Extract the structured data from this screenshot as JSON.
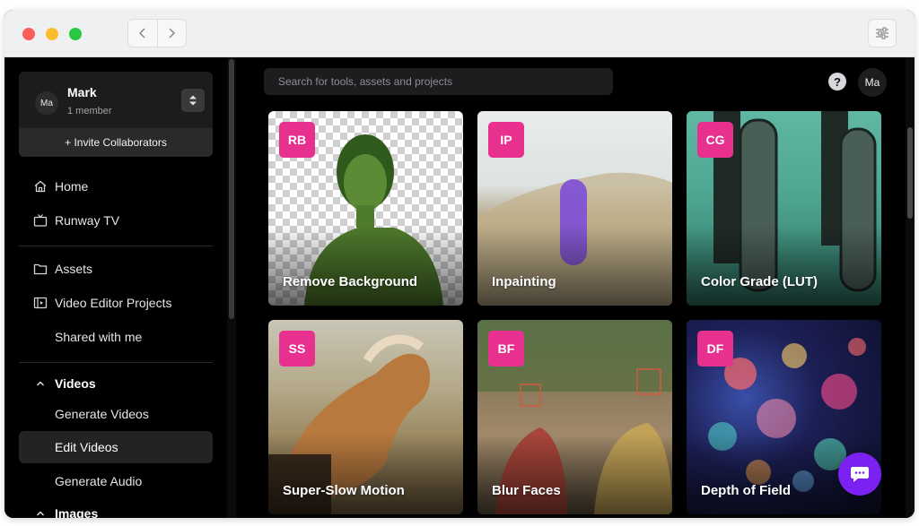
{
  "workspace": {
    "avatar": "Ma",
    "name": "Mark",
    "members": "1 member",
    "invite": "+ Invite Collaborators"
  },
  "nav": {
    "home": "Home",
    "runway_tv": "Runway TV",
    "assets": "Assets",
    "video_editor_projects": "Video Editor Projects",
    "shared_with_me": "Shared with me",
    "videos": "Videos",
    "generate_videos": "Generate Videos",
    "edit_videos": "Edit Videos",
    "generate_audio": "Generate Audio",
    "images": "Images"
  },
  "search": {
    "placeholder": "Search for tools, assets and projects"
  },
  "header": {
    "help": "?",
    "user_avatar": "Ma"
  },
  "tools": [
    {
      "badge": "RB",
      "title": "Remove Background"
    },
    {
      "badge": "IP",
      "title": "Inpainting"
    },
    {
      "badge": "CG",
      "title": "Color Grade (LUT)"
    },
    {
      "badge": "SS",
      "title": "Super-Slow Motion"
    },
    {
      "badge": "BF",
      "title": "Blur Faces"
    },
    {
      "badge": "DF",
      "title": "Depth of Field"
    }
  ],
  "colors": {
    "accent": "#e8308f",
    "chat": "#7b22f2",
    "background": "#000000"
  },
  "icons": {
    "home": "home-icon",
    "tv": "tv-icon",
    "folder": "folder-icon",
    "video_editor": "video-editor-icon",
    "chevron": "chevron-up-icon",
    "chat": "chat-icon",
    "settings": "sliders-icon"
  }
}
